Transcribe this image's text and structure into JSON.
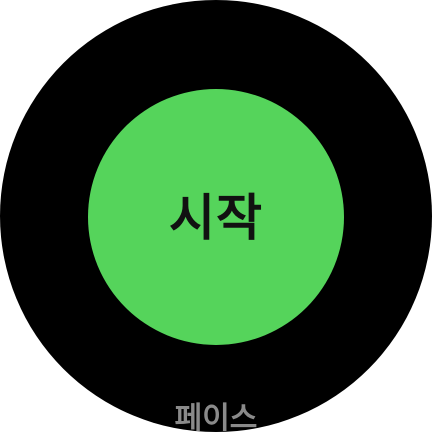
{
  "start_button": {
    "label": "시작"
  },
  "bottom_item": {
    "label": "페이스"
  },
  "colors": {
    "background": "#000000",
    "accent": "#55d45b",
    "label_text": "#111111",
    "secondary_text": "#8a8a8a"
  }
}
